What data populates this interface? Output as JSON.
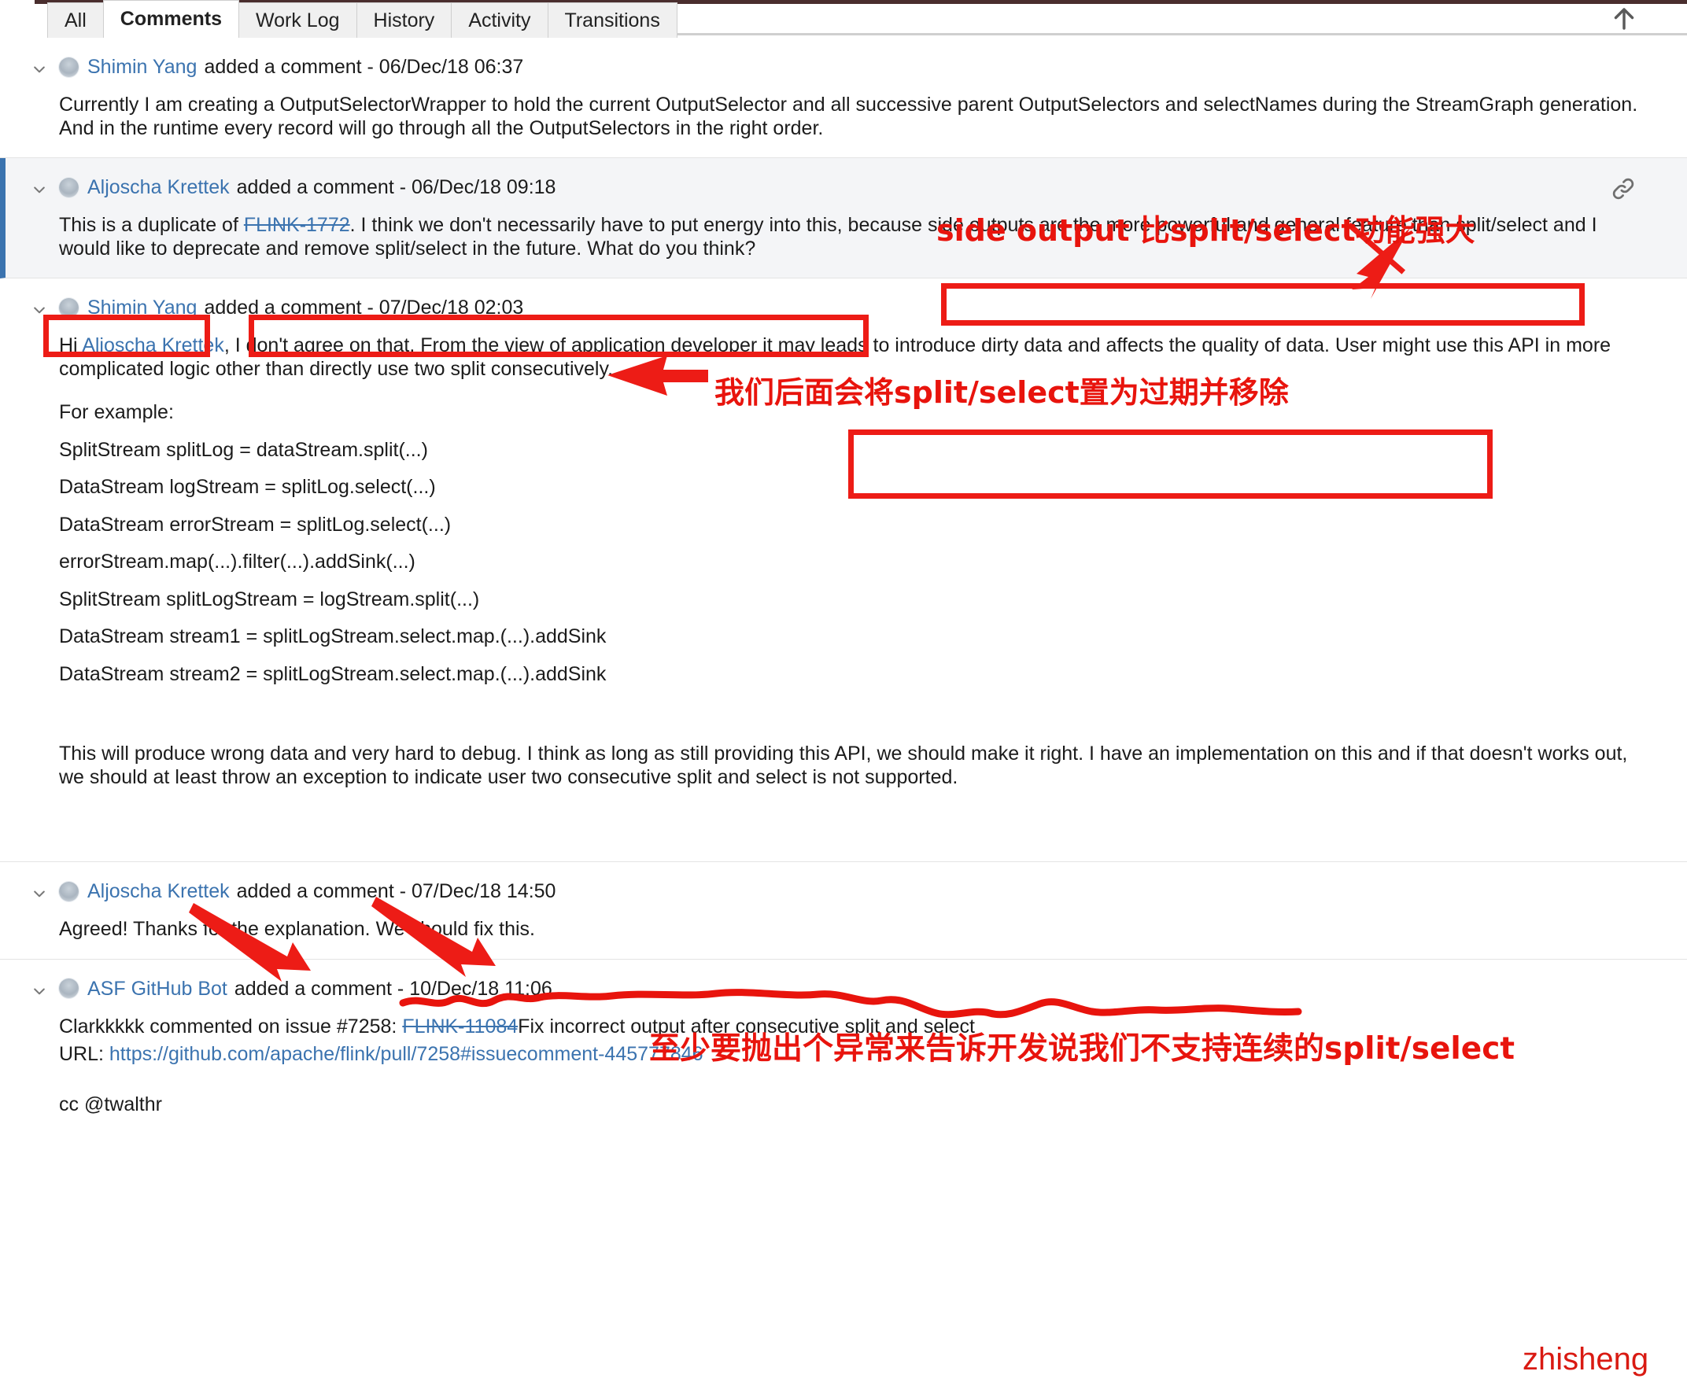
{
  "tabs": [
    {
      "label": "All",
      "active": false
    },
    {
      "label": "Comments",
      "active": true
    },
    {
      "label": "Work Log",
      "active": false
    },
    {
      "label": "History",
      "active": false
    },
    {
      "label": "Activity",
      "active": false
    },
    {
      "label": "Transitions",
      "active": false
    }
  ],
  "icons": {
    "scroll_to_top": "arrow-up-icon",
    "permalink": "link-icon",
    "collapse": "chevron-down-icon"
  },
  "comments": [
    {
      "author": "Shimin Yang",
      "meta": "added a comment - 06/Dec/18 06:37",
      "body": "Currently I am creating a OutputSelectorWrapper to hold the current OutputSelector and all successive parent OutputSelectors and selectNames during the StreamGraph generation. And in the runtime every record will go through all the OutputSelectors in the right order."
    },
    {
      "author": "Aljoscha Krettek",
      "meta": "added a comment - 06/Dec/18 09:18",
      "highlighted": true,
      "body_prefix": "This is a duplicate of ",
      "body_link": "FLINK-1772",
      "body_suffix": ". I think we don't necessarily have to put energy into this, because side outputs are the more powerful and general feature than split/select and I would like to deprecate and remove split/select in the future. What do you think?"
    },
    {
      "author": "Shimin Yang",
      "meta": "added a comment - 07/Dec/18 02:03",
      "para1_prefix": "Hi ",
      "para1_link": "Aljoscha Krettek",
      "para1_suffix": ", I don't agree on that. From the view of application developer it may leads to introduce dirty data and affects the quality of data. User might use this API in more complicated logic other than directly use two split consecutively.",
      "para_example": "For example:",
      "code_lines": [
        "SplitStream splitLog = dataStream.split(...)",
        "DataStream logStream = splitLog.select(...)",
        "DataStream errorStream = splitLog.select(...)",
        "errorStream.map(...).filter(...).addSink(...)",
        "SplitStream splitLogStream = logStream.split(...)",
        "DataStream stream1 = splitLogStream.select.map.(...).addSink",
        "DataStream stream2 = splitLogStream.select.map.(...).addSink"
      ],
      "para_last": "This will produce wrong data and very hard to debug. I think as long as still providing this API, we should make it right. I have an implementation on this and if that doesn't works out, we should at least throw an exception to indicate user two consecutive split and select is not supported."
    },
    {
      "author": "Aljoscha Krettek",
      "meta": "added a comment - 07/Dec/18 14:50",
      "body": "Agreed! Thanks for the explanation. We should fix this."
    },
    {
      "author": "ASF GitHub Bot",
      "meta": "added a comment - 10/Dec/18 11:06",
      "gh_prefix": "Clarkkkkk commented on issue #7258: ",
      "gh_issue_link": "FLINK-11084",
      "gh_suffix": "Fix incorrect output after consecutive split and select",
      "gh_url_label": "URL: ",
      "gh_url": "https://github.com/apache/flink/pull/7258#issuecomment-445777846",
      "gh_cc": "cc @twalthr"
    }
  ],
  "annotations": {
    "note_side_output": "side output 比split/select功能强大",
    "note_deprecate": "我们后面会将split/select置为过期并移除",
    "note_exception": "至少要抛出个异常来告诉开发说我们不支持连续的split/select",
    "watermark": "zhisheng",
    "accent_red": "#ed1c16",
    "accent_blue": "#3b73af",
    "highlight_bg": "#f4f5f7"
  }
}
